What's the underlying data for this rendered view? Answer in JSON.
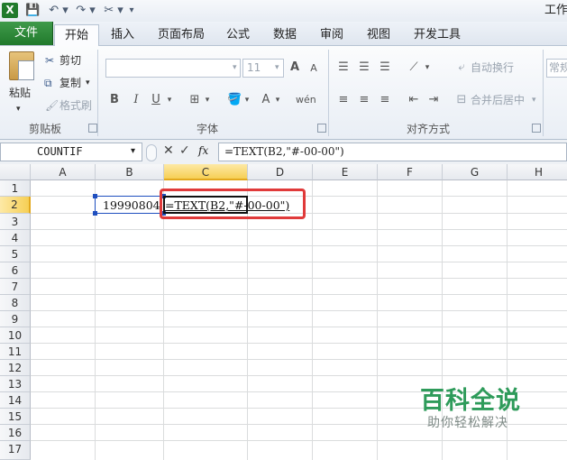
{
  "title_bar": {
    "app_title": "工作"
  },
  "tabs": [
    "文件",
    "开始",
    "插入",
    "页面布局",
    "公式",
    "数据",
    "审阅",
    "视图",
    "开发工具"
  ],
  "ribbon": {
    "clipboard": {
      "paste": "粘贴",
      "cut": "剪切",
      "copy": "复制",
      "format_painter": "格式刷",
      "group_label": "剪贴板"
    },
    "font": {
      "size": "11",
      "group_label": "字体"
    },
    "alignment": {
      "wrap_text": "自动换行",
      "merge_center": "合并后居中",
      "group_label": "对齐方式"
    },
    "number": {
      "format": "常规"
    }
  },
  "formula_bar": {
    "name_box": "COUNTIF",
    "fx": "fx",
    "formula": "=TEXT(B2,\"#-00-00\")"
  },
  "grid": {
    "columns": [
      "A",
      "B",
      "C",
      "D",
      "E",
      "F",
      "G",
      "H"
    ],
    "rows": [
      "1",
      "2",
      "3",
      "4",
      "5",
      "6",
      "7",
      "8",
      "9",
      "10",
      "11",
      "12",
      "13",
      "14",
      "15",
      "16",
      "17"
    ],
    "cells": {
      "B2": "19990804",
      "C2": "=TEXT(B2,\"#-00-00\")"
    }
  },
  "watermark": {
    "title": "百科全说",
    "subtitle": "助你轻松解决"
  },
  "colors": {
    "file_tab": "#2f8a3b",
    "selection_highlight": "#f7d45a",
    "annotation_box": "#e03a3a",
    "watermark": "#2e9b5a"
  }
}
